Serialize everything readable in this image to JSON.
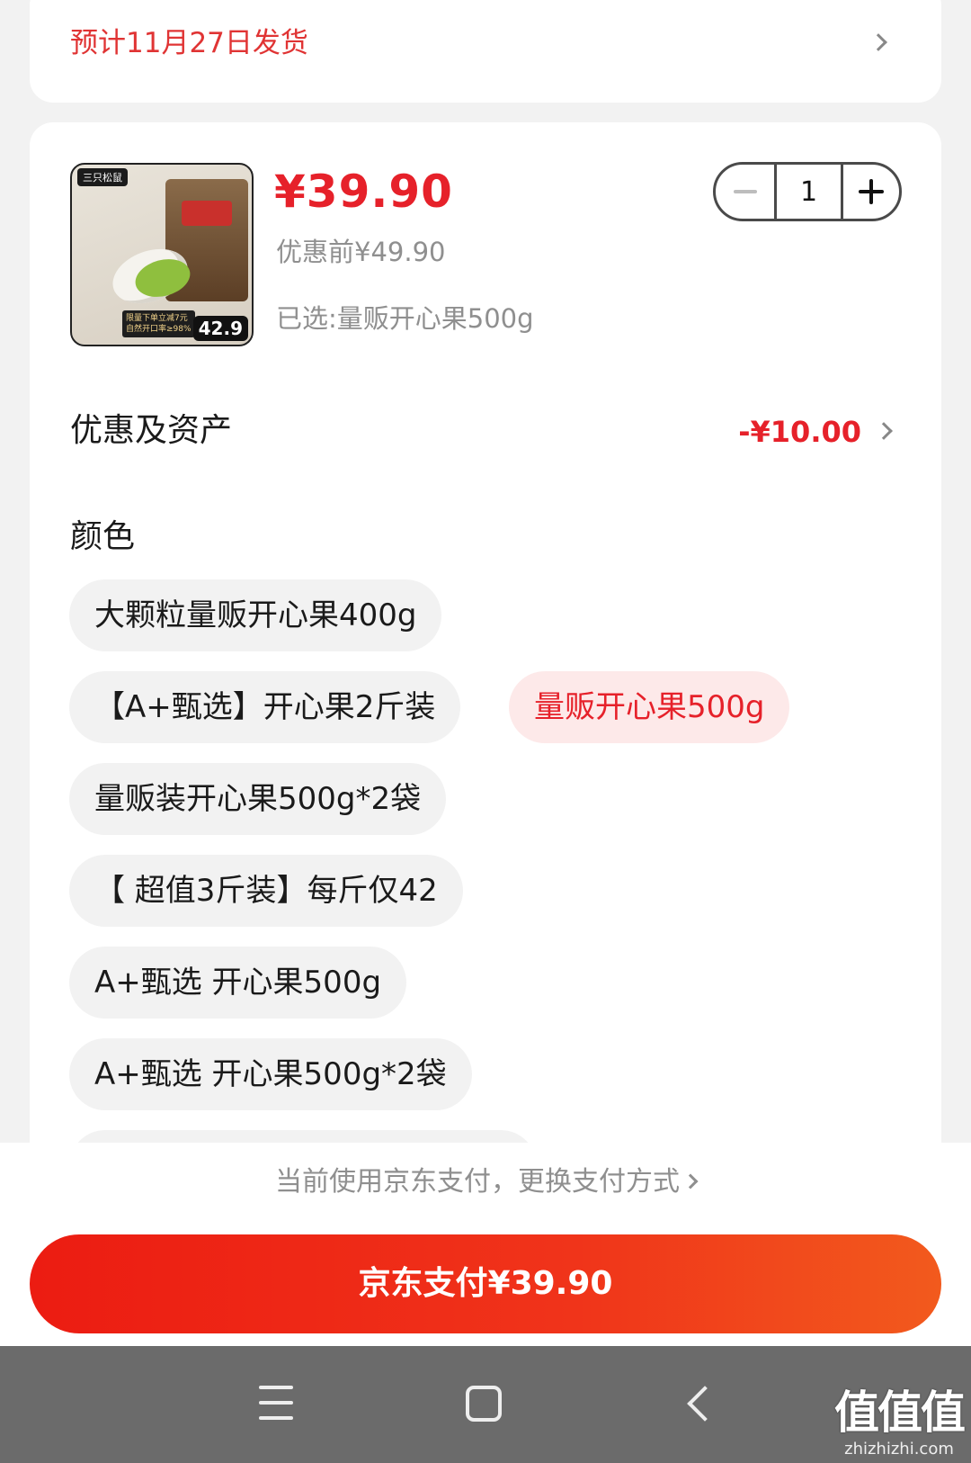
{
  "shipping": {
    "text": "预计11月27日发货"
  },
  "product": {
    "image": {
      "brand": "三只松鼠",
      "promo_line1": "限量下单立减7元",
      "promo_line2": "自然开口率≥98%",
      "price_tag": "42.9"
    },
    "price": "¥39.90",
    "original_price": "优惠前¥49.90",
    "selected": "已选:量贩开心果500g",
    "quantity": "1"
  },
  "assets": {
    "label": "优惠及资产",
    "value": "-¥10.00"
  },
  "color": {
    "label": "颜色",
    "options": [
      "大颗粒量贩开心果400g",
      "【A+甄选】开心果2斤装",
      "量贩开心果500g",
      "量贩装开心果500g*2袋",
      "【 超值3斤装】每斤仅42",
      "A+甄选 开心果500g",
      "A+甄选 开心果500g*2袋"
    ],
    "selected_index": 2
  },
  "payment": {
    "tip": "当前使用京东支付，更换支付方式",
    "button": "京东支付¥39.90"
  },
  "watermark": {
    "big": "值值值",
    "small": "zhizhizhi.com"
  },
  "colors": {
    "accent": "#e6212a",
    "button_start": "#ec1c12",
    "button_end": "#f25a1d"
  }
}
